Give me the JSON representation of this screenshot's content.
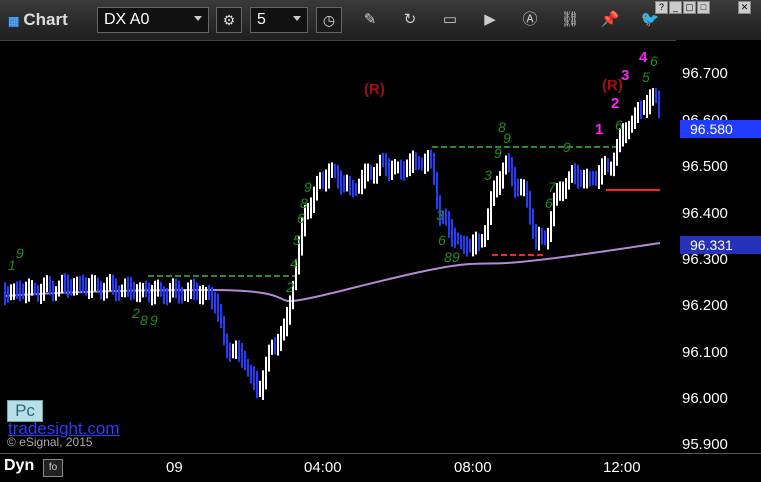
{
  "toolbar": {
    "title": "Chart",
    "symbol": "DX A0",
    "interval": "5"
  },
  "price_axis": {
    "labels": [
      "96.700",
      "96.600",
      "96.500",
      "96.400",
      "96.300",
      "96.200",
      "96.100",
      "96.000",
      "95.900"
    ],
    "last_price": "96.580",
    "ma_value": "96.331",
    "last_color": "#1f3cff",
    "ma_color": "#2531b8"
  },
  "time_axis": {
    "labels": [
      "09",
      "04:00",
      "08:00",
      "12:00"
    ]
  },
  "bottom": {
    "dyn_label": "Dyn"
  },
  "watermark": {
    "badge": "Pc",
    "site": "tradesight.com",
    "copyright": "© eSignal, 2015"
  },
  "annotations": {
    "r_label": "(R)",
    "seq": [
      "1",
      "2",
      "3",
      "4"
    ]
  },
  "colors": {
    "up_bar": "#ffffff",
    "down_bar": "#1f3cff",
    "ma_line": "#b48ad8",
    "setup_count": "#1e8f1e",
    "resistance": "#2a8a2a",
    "support": "#ff2020",
    "r_label": "#a01010",
    "seq": "#ff22ff"
  }
}
